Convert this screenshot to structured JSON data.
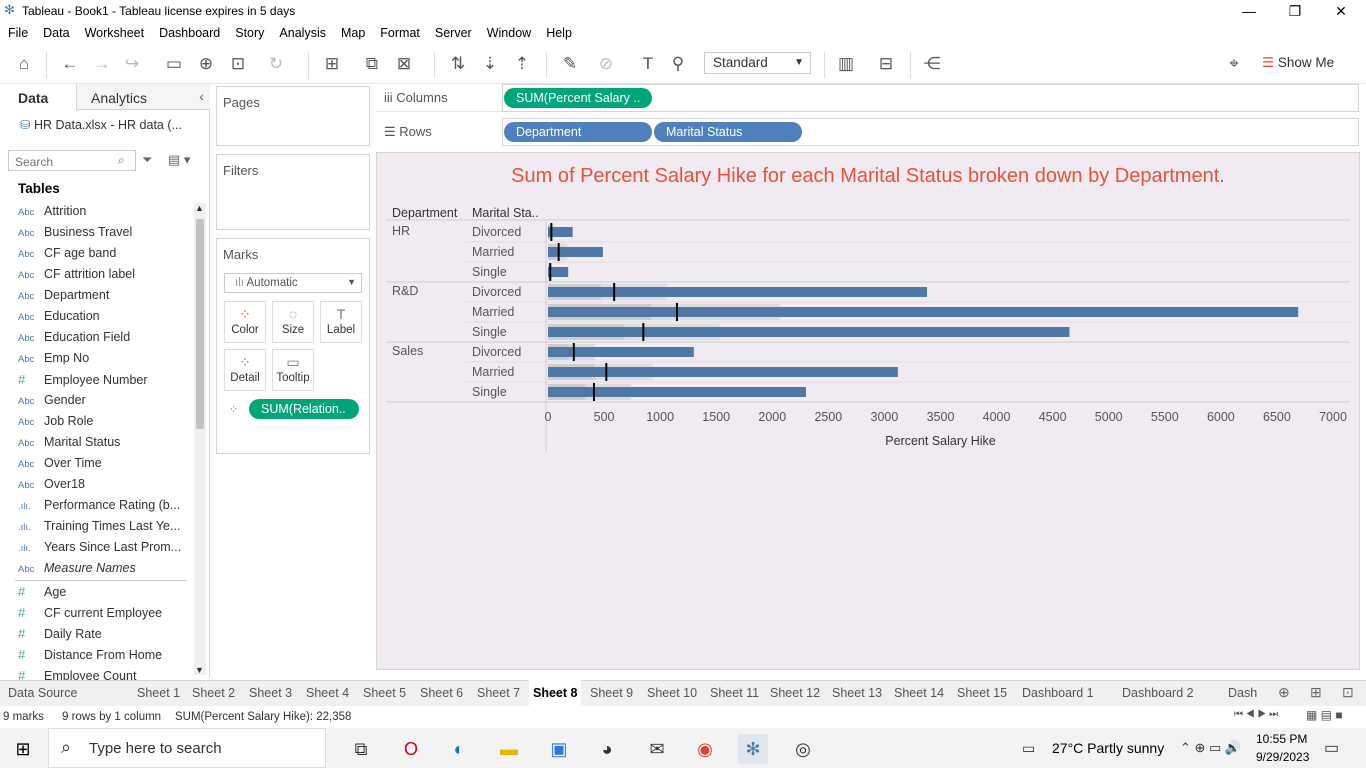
{
  "window": {
    "title": "Tableau - Book1 - Tableau license expires in 5 days"
  },
  "menu": [
    "File",
    "Data",
    "Worksheet",
    "Dashboard",
    "Story",
    "Analysis",
    "Map",
    "Format",
    "Server",
    "Window",
    "Help"
  ],
  "toolbar": {
    "fit": "Standard",
    "show_me": "Show Me"
  },
  "left_panel": {
    "tab_data": "Data",
    "tab_analytics": "Analytics",
    "datasource": "HR Data.xlsx - HR data (...",
    "search_placeholder": "Search",
    "tables_heading": "Tables",
    "fields": [
      {
        "type": "Abc",
        "name": "Attrition"
      },
      {
        "type": "Abc",
        "name": "Business Travel"
      },
      {
        "type": "Abc",
        "name": "CF age band"
      },
      {
        "type": "Abc",
        "name": "CF attrition label"
      },
      {
        "type": "Abc",
        "name": "Department"
      },
      {
        "type": "Abc",
        "name": "Education"
      },
      {
        "type": "Abc",
        "name": "Education Field"
      },
      {
        "type": "Abc",
        "name": "Emp No"
      },
      {
        "type": "#",
        "name": "Employee Number"
      },
      {
        "type": "Abc",
        "name": "Gender"
      },
      {
        "type": "Abc",
        "name": "Job Role"
      },
      {
        "type": "Abc",
        "name": "Marital Status"
      },
      {
        "type": "Abc",
        "name": "Over Time"
      },
      {
        "type": "Abc",
        "name": "Over18"
      },
      {
        "type": ".ılı.",
        "name": "Performance Rating (b..."
      },
      {
        "type": ".ılı.",
        "name": "Training Times Last Ye..."
      },
      {
        "type": ".ılı.",
        "name": "Years Since Last Prom..."
      },
      {
        "type": "Abc",
        "name": "Measure Names"
      }
    ],
    "measures": [
      {
        "type": "#",
        "name": "Age"
      },
      {
        "type": "#",
        "name": "CF current Employee"
      },
      {
        "type": "#",
        "name": "Daily Rate"
      },
      {
        "type": "#",
        "name": "Distance From Home"
      },
      {
        "type": "#",
        "name": "Employee Count"
      }
    ]
  },
  "cards": {
    "pages": "Pages",
    "filters": "Filters",
    "marks": "Marks",
    "mark_type": "Automatic",
    "buttons": [
      "Color",
      "Size",
      "Label",
      "Detail",
      "Tooltip"
    ],
    "detail_pill": "SUM(Relation.."
  },
  "shelves": {
    "columns_label": "Columns",
    "rows_label": "Rows",
    "columns_pills": [
      "SUM(Percent Salary .."
    ],
    "rows_pills": [
      "Department",
      "Marital Status"
    ]
  },
  "viz": {
    "title": "Sum of Percent Salary Hike for each Marital Status broken down by Department.",
    "header_department": "Department",
    "header_marital": "Marital Sta.."
  },
  "chart_data": {
    "type": "bar",
    "title": "Sum of Percent Salary Hike for each Marital Status broken down by Department.",
    "xlabel": "Percent Salary Hike",
    "ylabel": "",
    "xlim": [
      0,
      7000
    ],
    "xticks": [
      0,
      500,
      1000,
      1500,
      2000,
      2500,
      3000,
      3500,
      4000,
      4500,
      5000,
      5500,
      6000,
      6500,
      7000
    ],
    "groups": [
      {
        "department": "HR",
        "rows": [
          {
            "marital": "Divorced",
            "value": 220,
            "reference": 30
          },
          {
            "marital": "Married",
            "value": 490,
            "reference": 95
          },
          {
            "marital": "Single",
            "value": 180,
            "reference": 20
          }
        ]
      },
      {
        "department": "R&D",
        "rows": [
          {
            "marital": "Divorced",
            "value": 3380,
            "reference": 590
          },
          {
            "marital": "Married",
            "value": 6690,
            "reference": 1150
          },
          {
            "marital": "Single",
            "value": 4650,
            "reference": 850
          }
        ]
      },
      {
        "department": "Sales",
        "rows": [
          {
            "marital": "Divorced",
            "value": 1300,
            "reference": 230
          },
          {
            "marital": "Married",
            "value": 3120,
            "reference": 520
          },
          {
            "marital": "Single",
            "value": 2300,
            "reference": 410
          }
        ]
      }
    ],
    "bar_color": "#4e79a7",
    "band_color": "#d9d9d9",
    "reference_line_color": "#000000"
  },
  "sheets": [
    "Data Source",
    "Sheet 1",
    "Sheet 2",
    "Sheet 3",
    "Sheet 4",
    "Sheet 5",
    "Sheet 6",
    "Sheet 7",
    "Sheet 8",
    "Sheet 9",
    "Sheet 10",
    "Sheet 11",
    "Sheet 12",
    "Sheet 13",
    "Sheet 14",
    "Sheet 15",
    "Dashboard 1",
    "Dashboard 2",
    "Dash"
  ],
  "active_sheet": "Sheet 8",
  "status": {
    "marks": "9 marks",
    "rows": "9 rows by 1 column",
    "sum": "SUM(Percent Salary Hike): 22,358"
  },
  "taskbar": {
    "search": "Type here to search",
    "weather": "27°C  Partly sunny",
    "time": "10:55 PM",
    "date": "9/29/2023"
  }
}
